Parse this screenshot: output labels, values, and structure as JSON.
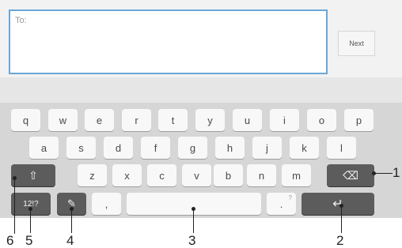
{
  "recipient": {
    "label": "To:"
  },
  "next_button": {
    "label": "Next"
  },
  "keyboard": {
    "row1": [
      "q",
      "w",
      "e",
      "r",
      "t",
      "y",
      "u",
      "i",
      "o",
      "p"
    ],
    "row2": [
      "a",
      "s",
      "d",
      "f",
      "g",
      "h",
      "j",
      "k",
      "l"
    ],
    "row3": [
      "z",
      "x",
      "c",
      "v",
      "b",
      "n",
      "m"
    ],
    "shift_icon": "⇧",
    "backspace_icon": "⌫",
    "symbols_label": "12!?",
    "settings_icon": "✎",
    "comma": ",",
    "period": ".",
    "period_hint": "?",
    "enter_icon": "↵"
  },
  "callouts": [
    "1",
    "2",
    "3",
    "4",
    "5",
    "6"
  ]
}
